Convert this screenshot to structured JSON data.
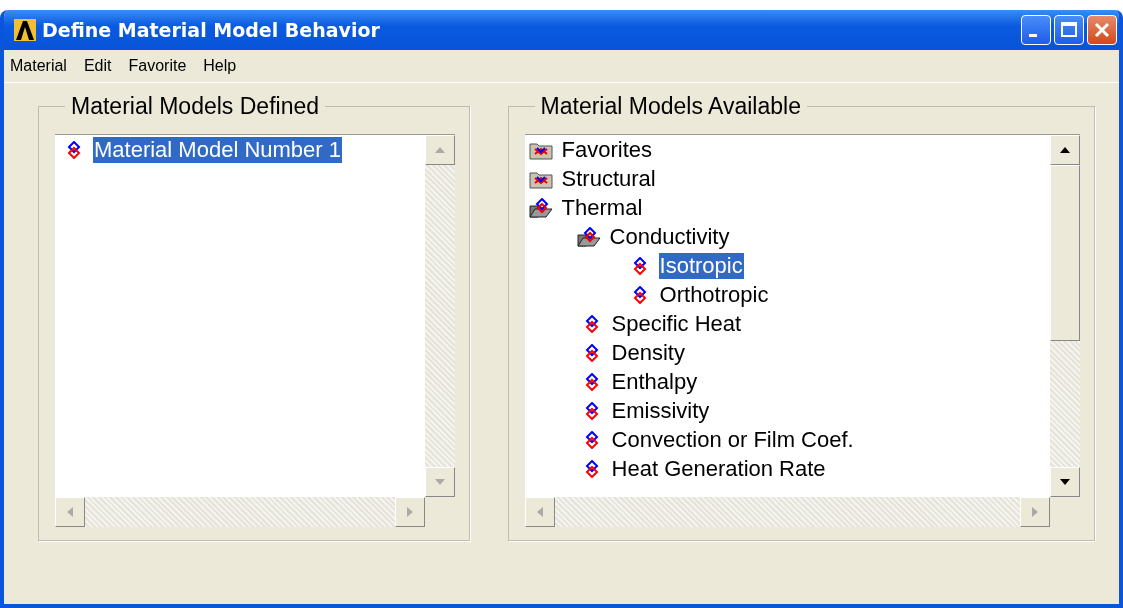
{
  "window": {
    "title": "Define Material Model Behavior"
  },
  "menu": [
    "Material",
    "Edit",
    "Favorite",
    "Help"
  ],
  "defined": {
    "title": "Material Models Defined",
    "items": [
      {
        "label": "Material Model Number 1",
        "selected": true
      }
    ]
  },
  "available": {
    "title": "Material Models Available",
    "items": [
      {
        "kind": "folder",
        "label": "Favorites",
        "expanded": false,
        "selected": false
      },
      {
        "kind": "folder",
        "label": "Structural",
        "expanded": false,
        "selected": false
      },
      {
        "kind": "folder",
        "label": "Thermal",
        "expanded": true,
        "selected": false,
        "children": [
          {
            "kind": "folder",
            "label": "Conductivity",
            "expanded": true,
            "selected": false,
            "children": [
              {
                "kind": "model",
                "label": "Isotropic",
                "selected": true
              },
              {
                "kind": "model",
                "label": "Orthotropic",
                "selected": false
              }
            ]
          },
          {
            "kind": "model",
            "label": "Specific Heat",
            "selected": false
          },
          {
            "kind": "model",
            "label": "Density",
            "selected": false
          },
          {
            "kind": "model",
            "label": "Enthalpy",
            "selected": false
          },
          {
            "kind": "model",
            "label": "Emissivity",
            "selected": false
          },
          {
            "kind": "model",
            "label": "Convection or Film Coef.",
            "selected": false
          },
          {
            "kind": "model",
            "label": "Heat Generation Rate",
            "selected": false
          }
        ]
      }
    ]
  }
}
